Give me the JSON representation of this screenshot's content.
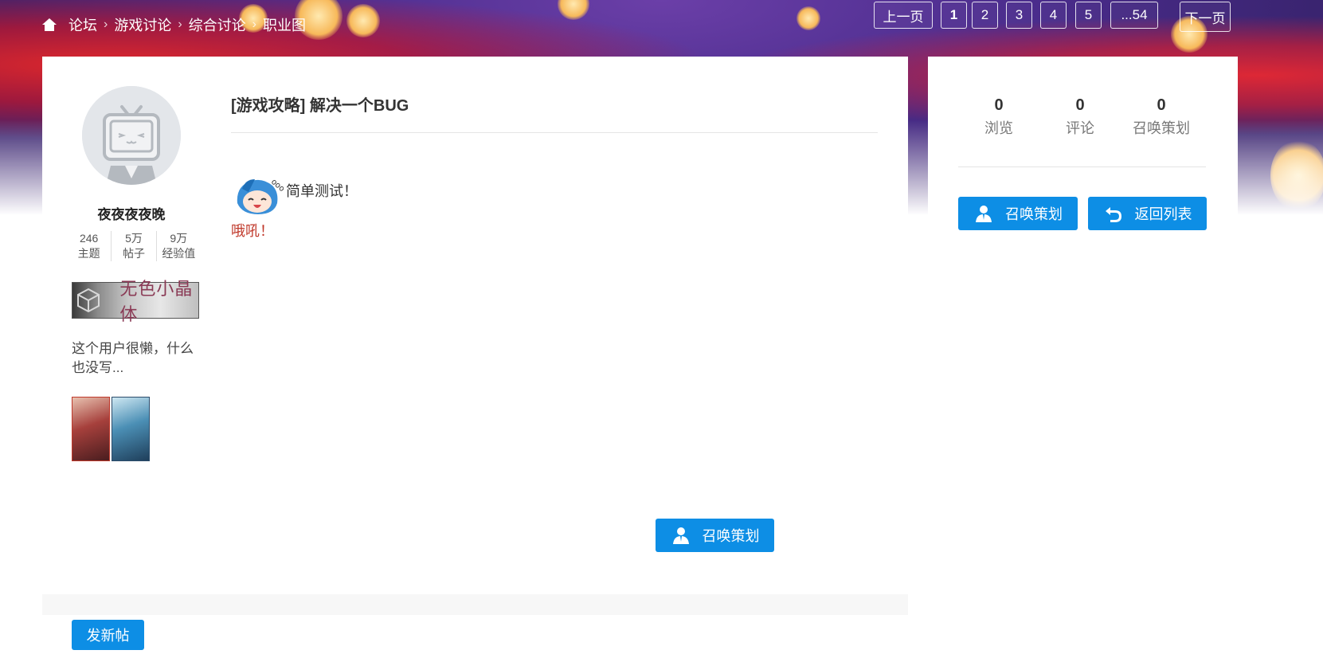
{
  "breadcrumb": {
    "items": [
      "论坛",
      "游戏讨论",
      "综合讨论",
      "职业图"
    ]
  },
  "pagination": {
    "prev_label": "上一页",
    "pages": [
      "1",
      "2",
      "3",
      "4",
      "5"
    ],
    "last_label": "...54",
    "next_label": "下一页",
    "current_page": "1"
  },
  "author": {
    "name": "夜夜夜夜晚",
    "stats": [
      {
        "value": "246",
        "label": "主题"
      },
      {
        "value": "5万",
        "label": "帖子"
      },
      {
        "value": "9万",
        "label": "经验值"
      }
    ],
    "badge_text": "无色小晶体",
    "bio": "这个用户很懒，什么也没写..."
  },
  "post": {
    "title": "[游戏攻略] 解决一个BUG",
    "body_line1": "简单测试！",
    "body_line2": "哦吼！",
    "summon_label": "召唤策划"
  },
  "sidebar": {
    "stats": [
      {
        "value": "0",
        "label": "浏览"
      },
      {
        "value": "0",
        "label": "评论"
      },
      {
        "value": "0",
        "label": "召唤策划"
      }
    ],
    "summon_label": "召唤策划",
    "back_label": "返回列表"
  },
  "footer": {
    "new_post_label": "发新帖"
  },
  "colors": {
    "accent": "#0d8ee5",
    "red_text": "#c0392b"
  }
}
